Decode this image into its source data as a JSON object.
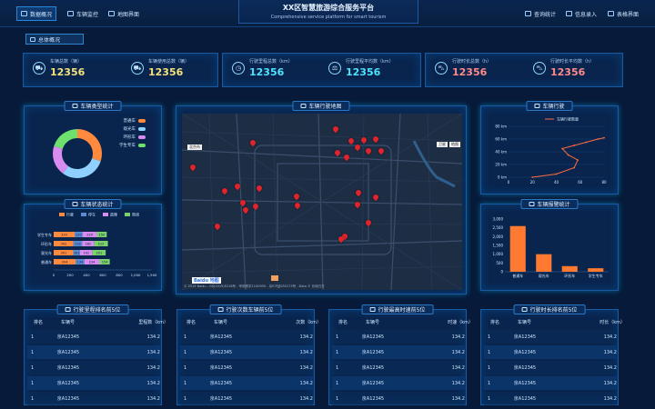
{
  "header": {
    "title": "XX区智慧旅游综合服务平台",
    "subtitle": "Comprehensive service platform for smart tourism",
    "nav_left": [
      {
        "label": "数据概况",
        "icon": "dashboard-icon",
        "active": true
      },
      {
        "label": "车辆监控",
        "icon": "car-icon",
        "active": false
      },
      {
        "label": "地图界面",
        "icon": "map-icon",
        "active": false
      }
    ],
    "nav_right": [
      {
        "label": "查询统计",
        "icon": "bar-chart-icon"
      },
      {
        "label": "信息录入",
        "icon": "edit-icon"
      },
      {
        "label": "表格界面",
        "icon": "table-icon"
      }
    ]
  },
  "overview_tab": {
    "label": "总体概况",
    "icon": "home-icon"
  },
  "stats": [
    {
      "label": "车辆总数（辆）",
      "value": "12356",
      "icon": "car-icon",
      "color": "#f6e27a"
    },
    {
      "label": "车辆使用总数（辆）",
      "value": "12356",
      "icon": "car-icon",
      "color": "#f6e27a"
    },
    {
      "label": "行驶里程总数（km）",
      "value": "12356",
      "icon": "clock-icon",
      "color": "#4fe3ff"
    },
    {
      "label": "行驶里程平均数（km）",
      "value": "12356",
      "icon": "balance-icon",
      "color": "#4fe3ff"
    },
    {
      "label": "行驶时长总数（h）",
      "value": "12356",
      "icon": "cart-icon",
      "color": "#ff8a8a"
    },
    {
      "label": "行驶时长平均数（h）",
      "value": "12356",
      "icon": "cart-icon",
      "color": "#ff8a8a"
    }
  ],
  "panels": {
    "vehicle_type": {
      "title": "车辆类型统计",
      "icon": "car-icon"
    },
    "vehicle_status": {
      "title": "车辆状态统计",
      "icon": "shield-icon"
    },
    "map": {
      "title": "车辆行驶地图",
      "icon": "compass-icon"
    },
    "vehicle_travel": {
      "title": "车辆行驶",
      "icon": "car-icon"
    },
    "vehicle_alarm": {
      "title": "车辆报警统计",
      "icon": "car-icon"
    }
  },
  "map_labels": {
    "city_label": "北京市",
    "zoom_label": "卫星",
    "map_label": "地图",
    "brand": "Baidu 地图",
    "copyright": "© 2019 Baidu - GS(2019)5218号 - 甲测资字1100930 - 京ICP证030173号 - Data © 长地万方"
  },
  "tables": [
    {
      "title": "行驶里程排名前5位",
      "headers": [
        "排名",
        "车辆号",
        "里程数（km）"
      ],
      "rows": [
        [
          "1",
          "京A12345",
          "134.2"
        ],
        [
          "1",
          "京A12345",
          "134.2"
        ],
        [
          "1",
          "京A12345",
          "134.2"
        ],
        [
          "1",
          "京A12345",
          "134.2"
        ],
        [
          "1",
          "京A12345",
          "134.2"
        ]
      ]
    },
    {
      "title": "行驶次数车辆前5位",
      "headers": [
        "排名",
        "车辆号",
        "次数（km）"
      ],
      "rows": [
        [
          "1",
          "京A12345",
          "134.2"
        ],
        [
          "1",
          "京A12345",
          "134.2"
        ],
        [
          "1",
          "京A12345",
          "134.2"
        ],
        [
          "1",
          "京A12345",
          "134.2"
        ],
        [
          "1",
          "京A12345",
          "134.2"
        ]
      ]
    },
    {
      "title": "行驶最高时速前5位",
      "headers": [
        "排名",
        "车辆号",
        "时速（km）"
      ],
      "rows": [
        [
          "1",
          "京A12345",
          "134.2"
        ],
        [
          "1",
          "京A12345",
          "134.2"
        ],
        [
          "1",
          "京A12345",
          "134.2"
        ],
        [
          "1",
          "京A12345",
          "134.2"
        ],
        [
          "1",
          "京A12345",
          "134.2"
        ]
      ]
    },
    {
      "title": "行驶时长排名前5位",
      "headers": [
        "排名",
        "车辆号",
        "时长（km）"
      ],
      "rows": [
        [
          "1",
          "京A12345",
          "134.2"
        ],
        [
          "1",
          "京A12345",
          "134.2"
        ],
        [
          "1",
          "京A12345",
          "134.2"
        ],
        [
          "1",
          "京A12345",
          "134.2"
        ],
        [
          "1",
          "京A12345",
          "134.2"
        ]
      ]
    }
  ],
  "chart_data": [
    {
      "type": "pie",
      "chart": "vehicle_type",
      "categories": [
        "普通车",
        "观光车",
        "环形车",
        "学生专车"
      ],
      "values": [
        30,
        30,
        20,
        20
      ],
      "colors": [
        "#ff8a3d",
        "#8fd0ff",
        "#d98cf0",
        "#6ee06e"
      ],
      "legend": "right"
    },
    {
      "type": "bar",
      "chart": "vehicle_status",
      "orientation": "horizontal",
      "stacked": true,
      "categories": [
        "学生专车",
        "环形车",
        "观光车",
        "普通车"
      ],
      "series": [
        {
          "name": "行驶",
          "values": [
            320,
            302,
            301,
            334
          ],
          "color": "#ff8a3d"
        },
        {
          "name": "停车",
          "values": [
            120,
            132,
            101,
            134
          ],
          "color": "#5a8bd8"
        },
        {
          "name": "故障",
          "values": [
            220,
            182,
            191,
            234
          ],
          "color": "#d98cf0"
        },
        {
          "name": "离线",
          "values": [
            150,
            212,
            201,
            154
          ],
          "color": "#7cd26a"
        }
      ],
      "xticks": [
        "0",
        "200",
        "400",
        "600",
        "800",
        "1,000",
        "1,500"
      ],
      "xlim": [
        0,
        1500
      ],
      "legend": "top"
    },
    {
      "type": "line",
      "chart": "vehicle_travel",
      "series": [
        {
          "name": "车辆行驶数量",
          "points": [
            [
              20,
              0
            ],
            [
              40,
              5
            ],
            [
              55,
              15
            ],
            [
              58,
              27
            ],
            [
              50,
              35
            ],
            [
              45,
              45
            ],
            [
              55,
              50
            ],
            [
              65,
              55
            ],
            [
              75,
              60
            ],
            [
              80,
              62
            ]
          ]
        }
      ],
      "xticks": [
        "0",
        "20",
        "40",
        "60",
        "80"
      ],
      "yticks": [
        "0 km",
        "20 km",
        "40 km",
        "60 km",
        "80 km"
      ],
      "xlim": [
        0,
        80
      ],
      "ylim": [
        0,
        80
      ],
      "color": "#ff6a3d",
      "legend": "top"
    },
    {
      "type": "bar",
      "chart": "vehicle_alarm",
      "categories": [
        "普通车",
        "观光车",
        "环形车",
        "学生专车"
      ],
      "values": [
        2600,
        1000,
        320,
        200
      ],
      "yticks": [
        "0",
        "500",
        "1,000",
        "1,500",
        "2,000",
        "2,500",
        "3,000"
      ],
      "ylim": [
        0,
        3000
      ],
      "color": "#ff7a30"
    }
  ]
}
